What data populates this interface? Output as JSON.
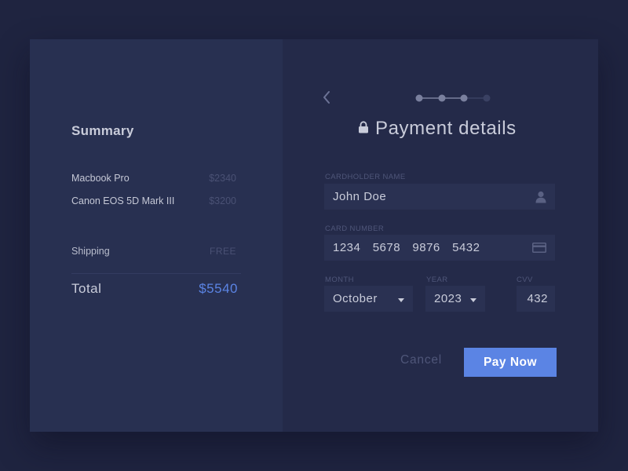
{
  "summary": {
    "title": "Summary",
    "items": [
      {
        "name": "Macbook Pro",
        "price": "$2340"
      },
      {
        "name": "Canon EOS 5D Mark III",
        "price": "$3200"
      }
    ],
    "shipping": {
      "label": "Shipping",
      "value": "FREE"
    },
    "total": {
      "label": "Total",
      "value": "$5540"
    }
  },
  "payment": {
    "title": "Payment details",
    "steps": {
      "total": 4,
      "current": 3
    },
    "fields": {
      "cardholder": {
        "label": "CARDHOLDER NAME",
        "value": "John Doe"
      },
      "card_number": {
        "label": "CARD NUMBER",
        "value": "1234  5678  9876  5432"
      },
      "month": {
        "label": "MONTH",
        "value": "October"
      },
      "year": {
        "label": "YEAR",
        "value": "2023"
      },
      "cvv": {
        "label": "CVV",
        "value": "432"
      }
    },
    "cancel_label": "Cancel",
    "pay_label": "Pay Now"
  },
  "colors": {
    "background": "#1f2440",
    "summary_panel": "#283051",
    "payment_panel": "#242a49",
    "field": "#2a3152",
    "accent": "#5b84e4",
    "muted_text": "#4f5679"
  },
  "icons": {
    "back": "chevron-left-icon",
    "lock": "lock-icon",
    "user": "user-icon",
    "card": "credit-card-icon",
    "dropdown": "caret-down-icon"
  }
}
